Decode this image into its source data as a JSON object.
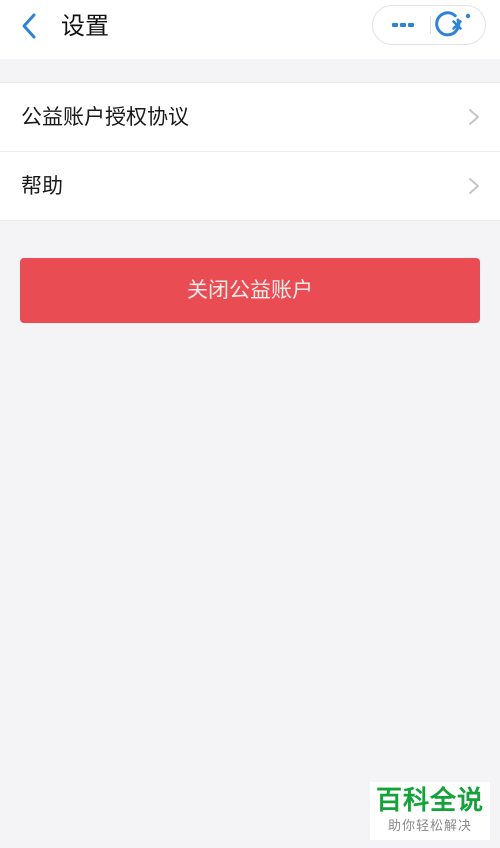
{
  "header": {
    "title": "设置",
    "back_icon": "chevron-left-icon",
    "more_icon": "more-dots-icon",
    "close_icon": "close-circle-icon"
  },
  "menu": {
    "items": [
      {
        "label": "公益账户授权协议",
        "icon": "chevron-right-icon"
      },
      {
        "label": "帮助",
        "icon": "chevron-right-icon"
      }
    ]
  },
  "actions": {
    "close_account_label": "关闭公益账户"
  },
  "watermark": {
    "title": "百科全说",
    "subtitle": "助你轻松解决"
  },
  "colors": {
    "background": "#f4f3f6",
    "accent_blue": "#2d83d6",
    "button_red": "#e94c52",
    "watermark_green": "#14a33a"
  }
}
